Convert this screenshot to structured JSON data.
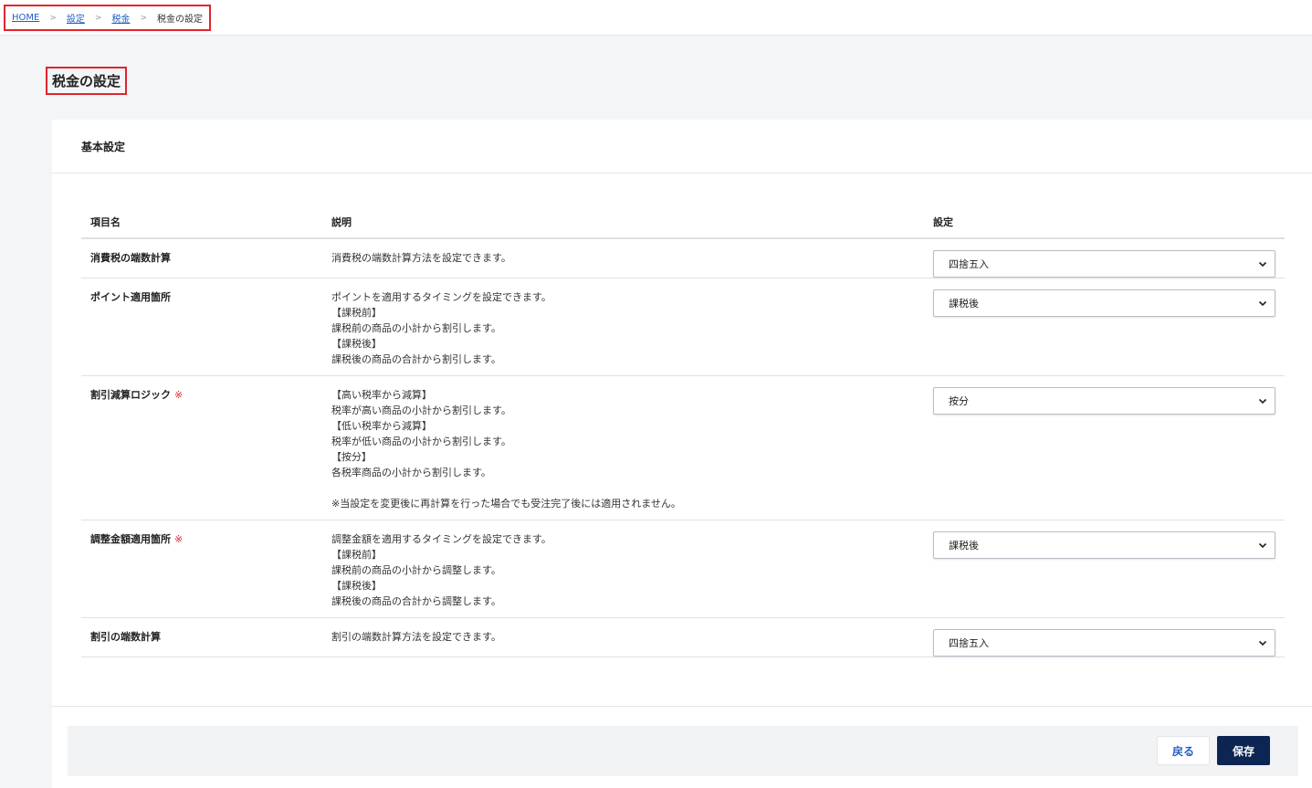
{
  "breadcrumb": {
    "home": "HOME",
    "settings": "設定",
    "tax": "税金",
    "current": "税金の設定",
    "separator": ">"
  },
  "page_title": "税金の設定",
  "section": {
    "title": "基本設定"
  },
  "table": {
    "headers": {
      "name": "項目名",
      "desc": "説明",
      "setting": "設定"
    },
    "required_mark": "※",
    "rows": [
      {
        "name": "消費税の端数計算",
        "desc": "消費税の端数計算方法を設定できます。",
        "value": "四捨五入"
      },
      {
        "name": "ポイント適用箇所",
        "desc": "ポイントを適用するタイミングを設定できます。\n【課税前】\n課税前の商品の小計から割引します。\n【課税後】\n課税後の商品の合計から割引します。",
        "value": "課税後"
      },
      {
        "name": "割引減算ロジック",
        "desc": "【高い税率から減算】\n税率が高い商品の小計から割引します。\n【低い税率から減算】\n税率が低い商品の小計から割引します。\n【按分】\n各税率商品の小計から割引します。\n\n※当設定を変更後に再計算を行った場合でも受注完了後には適用されません。",
        "value": "按分"
      },
      {
        "name": "調整金額適用箇所",
        "desc": "調整金額を適用するタイミングを設定できます。\n【課税前】\n課税前の商品の小計から調整します。\n【課税後】\n課税後の商品の合計から調整します。",
        "value": "課税後"
      },
      {
        "name": "割引の端数計算",
        "desc": "割引の端数計算方法を設定できます。",
        "value": "四捨五入"
      }
    ]
  },
  "buttons": {
    "back": "戻る",
    "save": "保存"
  },
  "colors": {
    "accent_red": "#e0252b",
    "link_blue": "#1f5fc7",
    "save_navy": "#0c2553"
  }
}
